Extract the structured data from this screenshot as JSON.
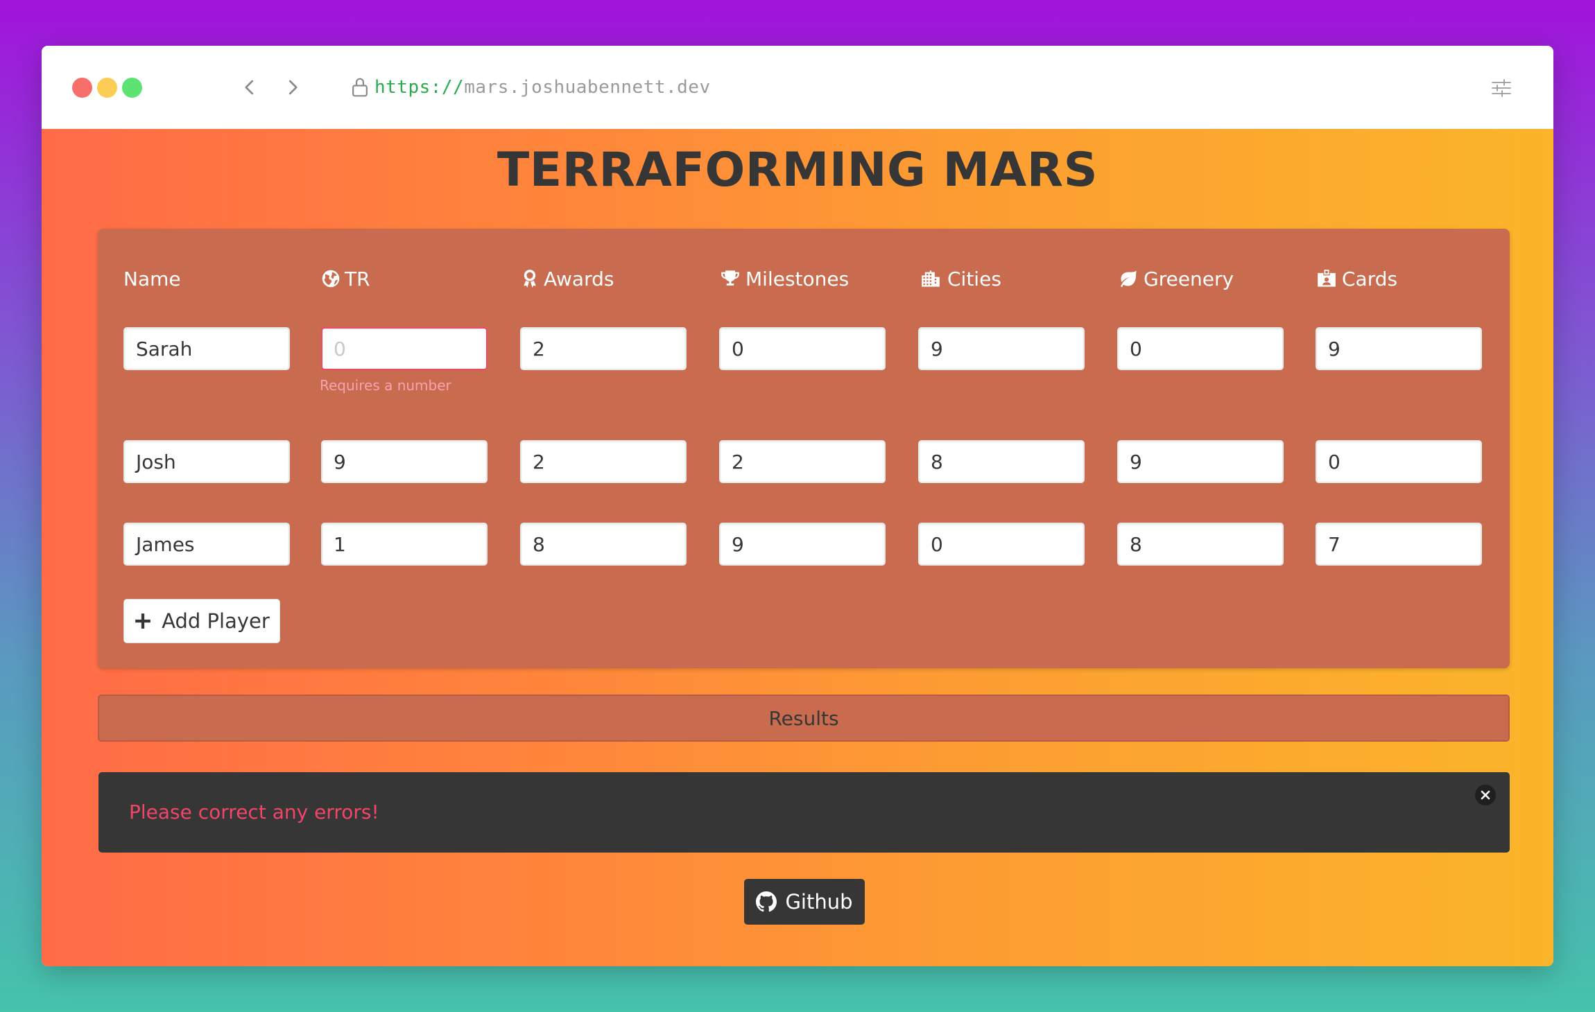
{
  "browser": {
    "url_scheme": "https://",
    "url_host": "mars.joshuabennett.dev",
    "traffic_lights": [
      "#f66f6a",
      "#fbcd55",
      "#5ce374"
    ]
  },
  "page": {
    "title": "TERRAFORMING MARS",
    "columns": [
      {
        "label": "Name",
        "icon": "none"
      },
      {
        "label": "TR",
        "icon": "globe-icon"
      },
      {
        "label": "Awards",
        "icon": "award-icon"
      },
      {
        "label": "Milestones",
        "icon": "trophy-icon"
      },
      {
        "label": "Cities",
        "icon": "city-icon"
      },
      {
        "label": "Greenery",
        "icon": "leaf-icon"
      },
      {
        "label": "Cards",
        "icon": "id-card-icon"
      }
    ],
    "players": [
      {
        "name": "Sarah",
        "tr": "",
        "tr_placeholder": "0",
        "awards": "2",
        "milestones": "0",
        "cities": "9",
        "greenery": "0",
        "cards": "9"
      },
      {
        "name": "Josh",
        "tr": "9",
        "awards": "2",
        "milestones": "2",
        "cities": "8",
        "greenery": "9",
        "cards": "0"
      },
      {
        "name": "James",
        "tr": "1",
        "awards": "8",
        "milestones": "9",
        "cities": "0",
        "greenery": "8",
        "cards": "7"
      }
    ],
    "tr_error_help": "Requires a number",
    "add_player_label": "Add Player",
    "results_label": "Results",
    "notification_text": "Please correct any errors!",
    "github_label": "Github"
  },
  "colors": {
    "card_bg": "#c96b4e",
    "error": "#f14668",
    "dark": "#363636"
  }
}
